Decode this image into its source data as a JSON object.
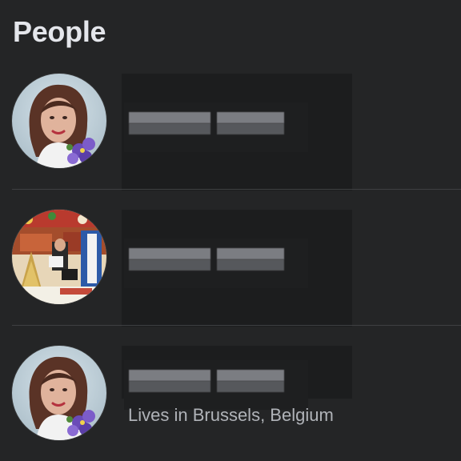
{
  "section": {
    "title": "People"
  },
  "people": [
    {
      "avatar_icon": "profile-photo-woman-flowers",
      "subtitle": ""
    },
    {
      "avatar_icon": "profile-photo-christmas-collage",
      "subtitle": ""
    },
    {
      "avatar_icon": "profile-photo-woman-flowers",
      "subtitle": "Lives in Brussels, Belgium"
    }
  ],
  "colors": {
    "background": "#242526",
    "primary_text": "#e4e6eb",
    "secondary_text": "#b0b3b8",
    "divider": "#3e4042"
  }
}
